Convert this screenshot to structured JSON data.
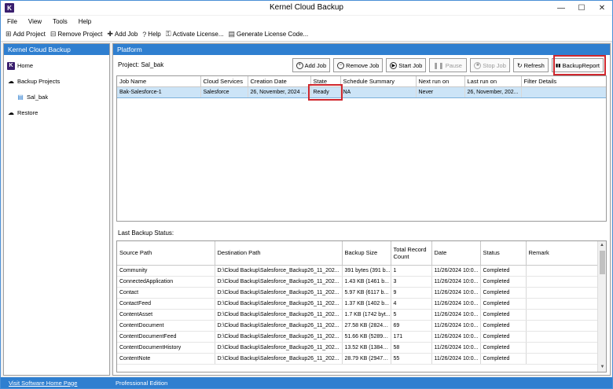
{
  "window": {
    "title": "Kernel Cloud Backup",
    "logo_letter": "K",
    "controls": [
      "—",
      "☐",
      "✕"
    ]
  },
  "menu": [
    "File",
    "View",
    "Tools",
    "Help"
  ],
  "toolbar": {
    "items": [
      {
        "icon": "add-project-icon",
        "glyph": "⊞",
        "label": "Add Project"
      },
      {
        "icon": "remove-project-icon",
        "glyph": "⊟",
        "label": "Remove Project"
      },
      {
        "icon": "plus-icon",
        "glyph": "✚",
        "label": "Add Job"
      },
      {
        "icon": "help-icon",
        "glyph": "?",
        "label": "Help"
      },
      {
        "icon": "key-icon",
        "glyph": "⚿",
        "label": "Activate License..."
      },
      {
        "icon": "license-icon",
        "glyph": "▤",
        "label": "Generate License Code..."
      }
    ]
  },
  "sidebar": {
    "header": "Kernel Cloud Backup",
    "items": [
      {
        "icon": "home-icon",
        "glyph": "K",
        "label": "Home"
      },
      {
        "icon": "cloud-icon",
        "glyph": "☁",
        "label": "Backup Projects"
      },
      {
        "icon": "document-icon",
        "glyph": "▤",
        "label": "Sal_bak"
      },
      {
        "icon": "restore-icon",
        "glyph": "☁",
        "label": "Restore"
      }
    ]
  },
  "main": {
    "header": "Platform",
    "project_label": "Project: Sal_bak",
    "job_buttons": [
      {
        "name": "add-job-button",
        "glyph": "+",
        "label": "Add Job",
        "enabled": true
      },
      {
        "name": "remove-job-button",
        "glyph": "−",
        "label": "Remove Job",
        "enabled": true
      },
      {
        "name": "start-job-button",
        "glyph": "▶",
        "label": "Start Job",
        "enabled": true
      },
      {
        "name": "pause-button",
        "glyph": "❚❚",
        "label": "Pause",
        "enabled": false
      },
      {
        "name": "stop-job-button",
        "glyph": "■",
        "label": "Stop Job",
        "enabled": false
      },
      {
        "name": "refresh-button",
        "glyph": "↻",
        "label": "Refresh",
        "enabled": true
      },
      {
        "name": "backup-report-button",
        "glyph": "▮▮",
        "label": "BackupReport",
        "enabled": true
      }
    ],
    "jobs": {
      "columns": [
        "Job Name",
        "Cloud Services",
        "Creation Date",
        "State",
        "Schedule Summary",
        "Next run on",
        "Last run on",
        "Filter Details"
      ],
      "rows": [
        [
          "Bak-Salesforce-1",
          "Salesforce",
          "26, November, 2024 ...",
          "Ready",
          "NA",
          "Never",
          "26, November, 202...",
          ""
        ]
      ]
    },
    "last_status_label": "Last Backup Status:",
    "status": {
      "columns": [
        "Source Path",
        "Destination Path",
        "Backup Size",
        "Total Record Count",
        "Date",
        "Status",
        "Remark"
      ],
      "rows": [
        [
          "Community",
          "D:\\Cloud Backup\\Salesforce_Backup26_11_202...",
          "391 bytes (391 b...",
          "1",
          "11/26/2024 10:0...",
          "Completed",
          ""
        ],
        [
          "ConnectedApplication",
          "D:\\Cloud Backup\\Salesforce_Backup26_11_202...",
          "1.43 KB (1461 b...",
          "3",
          "11/26/2024 10:0...",
          "Completed",
          ""
        ],
        [
          "Contact",
          "D:\\Cloud Backup\\Salesforce_Backup26_11_202...",
          "5.97 KB (6117 b...",
          "9",
          "11/26/2024 10:0...",
          "Completed",
          ""
        ],
        [
          "ContactFeed",
          "D:\\Cloud Backup\\Salesforce_Backup26_11_202...",
          "1.37 KB (1402 b...",
          "4",
          "11/26/2024 10:0...",
          "Completed",
          ""
        ],
        [
          "ContentAsset",
          "D:\\Cloud Backup\\Salesforce_Backup26_11_202...",
          "1.7 KB (1742 byt...",
          "5",
          "11/26/2024 10:0...",
          "Completed",
          ""
        ],
        [
          "ContentDocument",
          "D:\\Cloud Backup\\Salesforce_Backup26_11_202...",
          "27.58 KB (28244...",
          "69",
          "11/26/2024 10:0...",
          "Completed",
          ""
        ],
        [
          "ContentDocumentFeed",
          "D:\\Cloud Backup\\Salesforce_Backup26_11_202...",
          "51.66 KB (52898...",
          "171",
          "11/26/2024 10:0...",
          "Completed",
          ""
        ],
        [
          "ContentDocumentHistory",
          "D:\\Cloud Backup\\Salesforce_Backup26_11_202...",
          "13.52 KB (13848...",
          "58",
          "11/26/2024 10:0...",
          "Completed",
          ""
        ],
        [
          "ContentNote",
          "D:\\Cloud Backup\\Salesforce_Backup26_11_202...",
          "28.79 KB (29478...",
          "55",
          "11/26/2024 10:0...",
          "Completed",
          ""
        ]
      ]
    }
  },
  "statusbar": {
    "link": "Visit Software Home Page",
    "edition": "Professional Edition"
  },
  "colors": {
    "accent": "#2f7fd0",
    "selection": "#cce4f7",
    "highlight": "#d0282e"
  }
}
